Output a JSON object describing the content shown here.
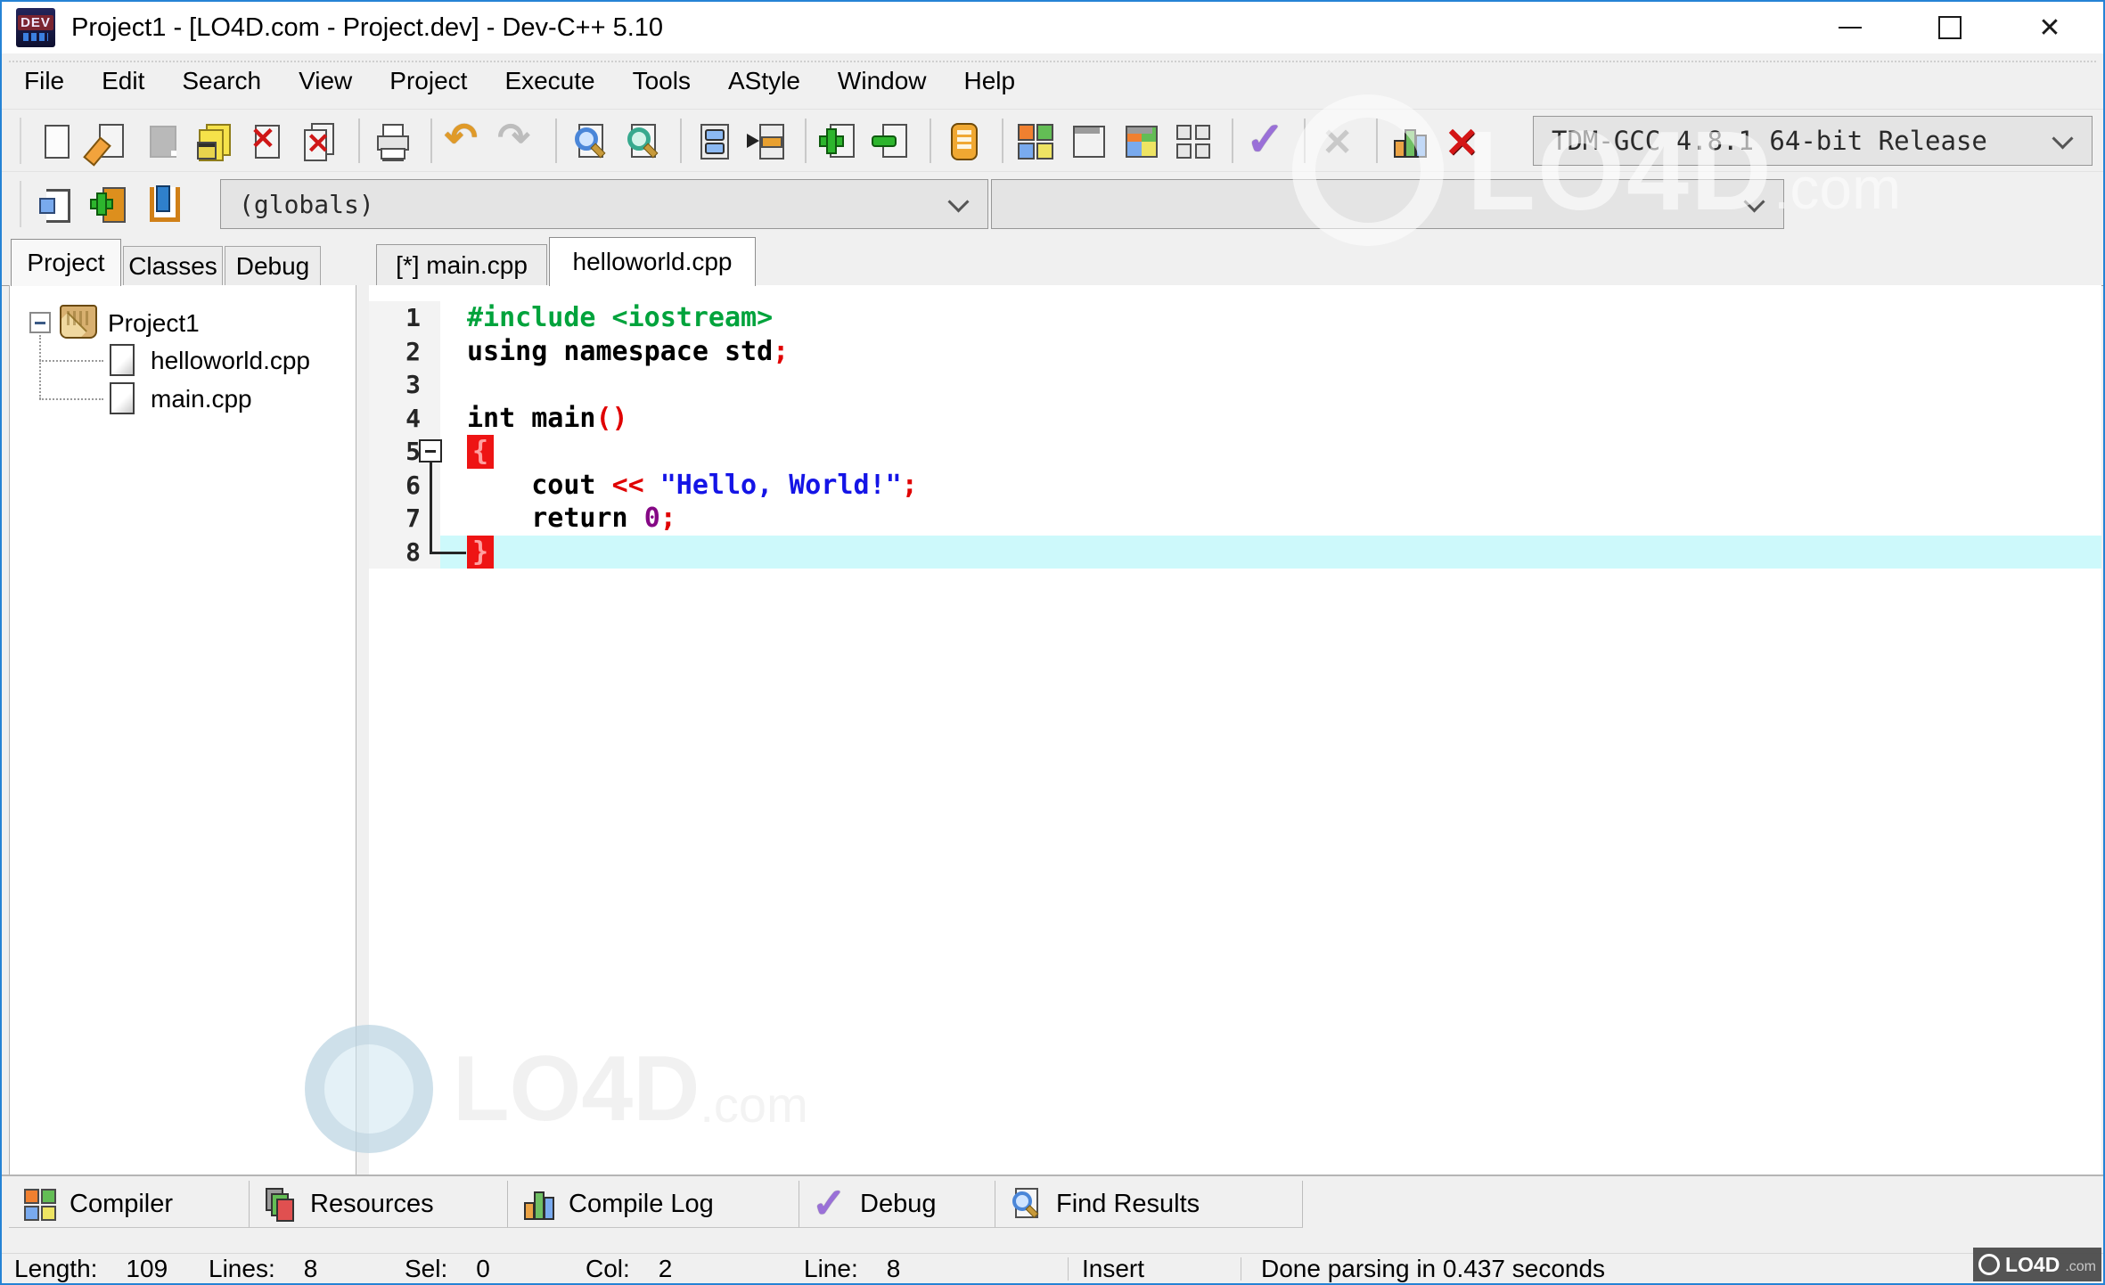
{
  "window": {
    "title": "Project1 - [LO4D.com - Project.dev] - Dev-C++ 5.10",
    "app_icon_text": "DEV"
  },
  "menu": {
    "items": [
      "File",
      "Edit",
      "Search",
      "View",
      "Project",
      "Execute",
      "Tools",
      "AStyle",
      "Window",
      "Help"
    ]
  },
  "toolbar_main": {
    "buttons": [
      {
        "name": "new-file"
      },
      {
        "name": "open-file"
      },
      {
        "name": "save-file",
        "disabled": true
      },
      {
        "name": "save-all"
      },
      {
        "name": "close-file"
      },
      {
        "name": "close-all"
      },
      {
        "name": "sep"
      },
      {
        "name": "print"
      },
      {
        "name": "sep"
      },
      {
        "name": "undo"
      },
      {
        "name": "redo",
        "disabled": true
      },
      {
        "name": "sep"
      },
      {
        "name": "find"
      },
      {
        "name": "replace"
      },
      {
        "name": "sep"
      },
      {
        "name": "compile"
      },
      {
        "name": "run"
      },
      {
        "name": "sep"
      },
      {
        "name": "add-to-project"
      },
      {
        "name": "remove-from-project"
      },
      {
        "name": "sep"
      },
      {
        "name": "package-manager"
      },
      {
        "name": "sep"
      },
      {
        "name": "new-project"
      },
      {
        "name": "new-window"
      },
      {
        "name": "project-options"
      },
      {
        "name": "window-layout"
      },
      {
        "name": "sep"
      },
      {
        "name": "check-syntax"
      },
      {
        "name": "sep"
      },
      {
        "name": "abort",
        "disabled": true
      },
      {
        "name": "sep"
      },
      {
        "name": "profile"
      },
      {
        "name": "abort-profile"
      }
    ],
    "compiler_combo_value": "TDM-GCC 4.8.1 64-bit Release"
  },
  "toolbar_nav": {
    "buttons": [
      {
        "name": "insert"
      },
      {
        "name": "add-bookmark"
      },
      {
        "name": "goto-bookmark"
      }
    ],
    "class_combo_value": "(globals)",
    "member_combo_value": ""
  },
  "left_panel": {
    "tabs": [
      {
        "label": "Project",
        "active": true
      },
      {
        "label": "Classes",
        "active": false
      },
      {
        "label": "Debug",
        "active": false
      }
    ],
    "tree": {
      "root": "Project1",
      "children": [
        "helloworld.cpp",
        "main.cpp"
      ]
    }
  },
  "editor": {
    "tabs": [
      {
        "label": "[*] main.cpp",
        "active": false
      },
      {
        "label": "helloworld.cpp",
        "active": true
      }
    ],
    "lines": [
      {
        "n": "1",
        "tokens": [
          {
            "t": "#include <iostream>",
            "c": "pp"
          }
        ]
      },
      {
        "n": "2",
        "tokens": [
          {
            "t": "using namespace std",
            "c": "kw"
          },
          {
            "t": ";",
            "c": "sym"
          }
        ]
      },
      {
        "n": "3",
        "tokens": []
      },
      {
        "n": "4",
        "tokens": [
          {
            "t": "int main",
            "c": "kw"
          },
          {
            "t": "()",
            "c": "sym"
          }
        ]
      },
      {
        "n": "5",
        "fold": "open",
        "tokens": [
          {
            "t": "{",
            "c": "brace"
          }
        ]
      },
      {
        "n": "6",
        "tokens": [
          {
            "t": "    ",
            "c": "pl"
          },
          {
            "t": "cout ",
            "c": "kw"
          },
          {
            "t": "<< ",
            "c": "sym"
          },
          {
            "t": "\"Hello, World!\"",
            "c": "str"
          },
          {
            "t": ";",
            "c": "sym"
          }
        ]
      },
      {
        "n": "7",
        "tokens": [
          {
            "t": "    ",
            "c": "pl"
          },
          {
            "t": "return ",
            "c": "kw"
          },
          {
            "t": "0",
            "c": "num"
          },
          {
            "t": ";",
            "c": "sym"
          }
        ]
      },
      {
        "n": "8",
        "fold": "close",
        "highlight": true,
        "tokens": [
          {
            "t": "}",
            "c": "brace"
          }
        ]
      }
    ]
  },
  "bottom_panel": {
    "tabs": [
      {
        "label": "Compiler",
        "icon": "compiler-grid"
      },
      {
        "label": "Resources",
        "icon": "resources-pages"
      },
      {
        "label": "Compile Log",
        "icon": "compile-log-chart"
      },
      {
        "label": "Debug",
        "icon": "debug-check"
      },
      {
        "label": "Find Results",
        "icon": "find-results"
      }
    ]
  },
  "status_bar": {
    "fields": [
      {
        "label": "Line:",
        "value": "8"
      },
      {
        "label": "Col:",
        "value": "2"
      },
      {
        "label": "Sel:",
        "value": "0"
      },
      {
        "label": "Lines:",
        "value": "8"
      },
      {
        "label": "Length:",
        "value": "109"
      }
    ],
    "mode": "Insert",
    "message": "Done parsing in 0.437 seconds"
  },
  "watermarks": {
    "logo_text": "LO4D",
    "logo_suffix": ".com",
    "badge_text": "LO4D",
    "badge_suffix": ".com"
  },
  "colors": {
    "accent_blue": "#2583d5",
    "syntax_green": "#00a33c",
    "syntax_red": "#e00000",
    "syntax_string_blue": "#1414e6",
    "syntax_number_purple": "#850885",
    "brace_highlight_bg": "#ee1414",
    "current_line_highlight": "#cdf9fb"
  }
}
